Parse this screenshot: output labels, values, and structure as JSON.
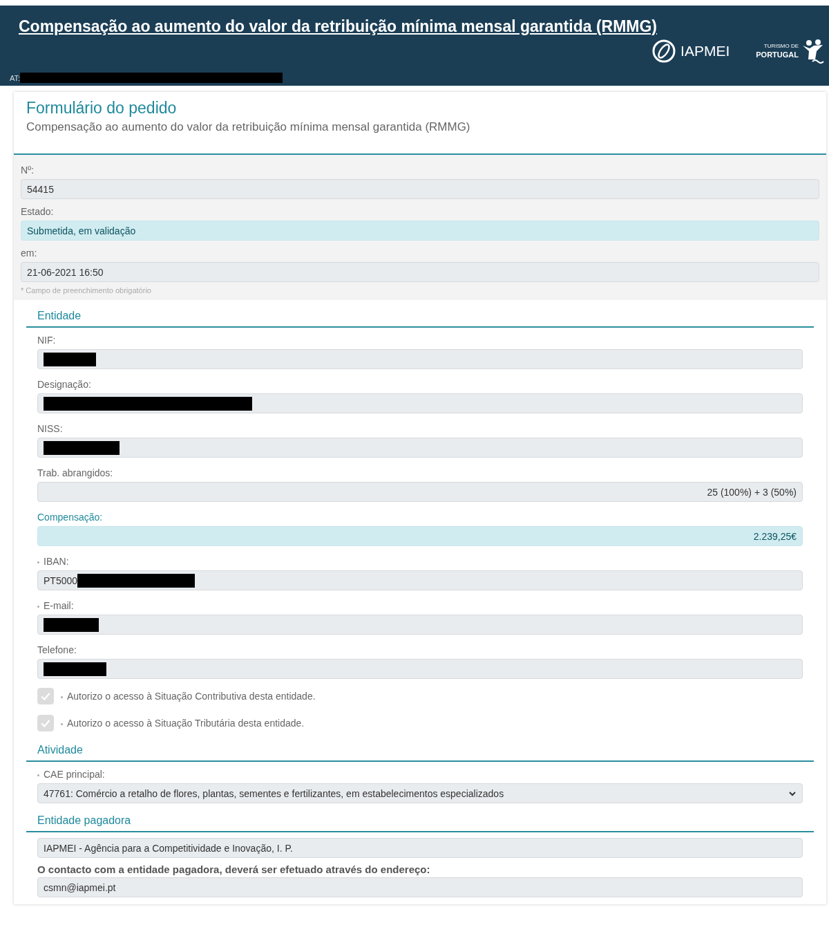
{
  "header": {
    "title": "Compensação ao aumento do valor da retribuição mínima mensal garantida (RMMG)",
    "at_label": "AT:",
    "at_redacted": true,
    "logo_text": "IAPMEI",
    "tourism_small": "TURISMO DE",
    "tourism_big": "PORTUGAL"
  },
  "form": {
    "title": "Formulário do pedido",
    "subtitle": "Compensação ao aumento do valor da retribuição mínima mensal garantida (RMMG)"
  },
  "status_fields": [
    {
      "label": "Nº:",
      "value": "54415",
      "kind": "text"
    },
    {
      "label": "Estado:",
      "value": "Submetida, em validação",
      "kind": "highlight"
    },
    {
      "label": "em:",
      "value": "21-06-2021 16:50",
      "kind": "text"
    }
  ],
  "note": "* Campo de preenchimento obrigatório",
  "sections": [
    {
      "title": "Entidade",
      "fields": [
        {
          "label": "NIF:",
          "kind": "text",
          "required": false,
          "redacted": true
        },
        {
          "label": "Designação:",
          "kind": "text",
          "required": false,
          "redacted": true
        },
        {
          "label": "NISS:",
          "kind": "text",
          "required": false,
          "redacted": true
        },
        {
          "label": "Trab. abrangidos:",
          "kind": "number",
          "required": false,
          "value": "25 (100%) + 3 (50%)",
          "redacted": false
        },
        {
          "label": "Compensação:",
          "kind": "highlight_number",
          "required": false,
          "value": "2.239,25€",
          "redacted": false
        },
        {
          "label": "IBAN:",
          "kind": "text",
          "required": true,
          "value": "PT5000",
          "redacted": true
        },
        {
          "label": "E-mail:",
          "kind": "text",
          "required": true,
          "redacted": true
        },
        {
          "label": "Telefone:",
          "kind": "text",
          "required": false,
          "redacted": true
        }
      ],
      "checkboxes": [
        {
          "label": "Autorizo o acesso à Situação Contributiva desta entidade.",
          "required": true,
          "checked": true,
          "disabled": true
        },
        {
          "label": "Autorizo o acesso à Situação Tributária desta entidade.",
          "required": true,
          "checked": true,
          "disabled": true
        }
      ]
    },
    {
      "title": "Atividade",
      "fields": [
        {
          "label": "CAE principal:",
          "kind": "select",
          "required": true,
          "value": "47761: Comércio a retalho de flores, plantas, sementes e fertilizantes, em estabelecimentos especializados",
          "redacted": false
        }
      ]
    },
    {
      "title": "Entidade pagadora",
      "fields": [
        {
          "kind": "text",
          "value": "IAPMEI - Agência para a Competitividade e Inovação, I. P.",
          "redacted": false
        },
        {
          "label": "O contacto com a entidade pagadora, deverá ser efetuado através do endereço:",
          "emphasis": true,
          "kind": "text",
          "required": false,
          "value": "csmn@iapmei.pt",
          "redacted": false
        }
      ]
    }
  ]
}
